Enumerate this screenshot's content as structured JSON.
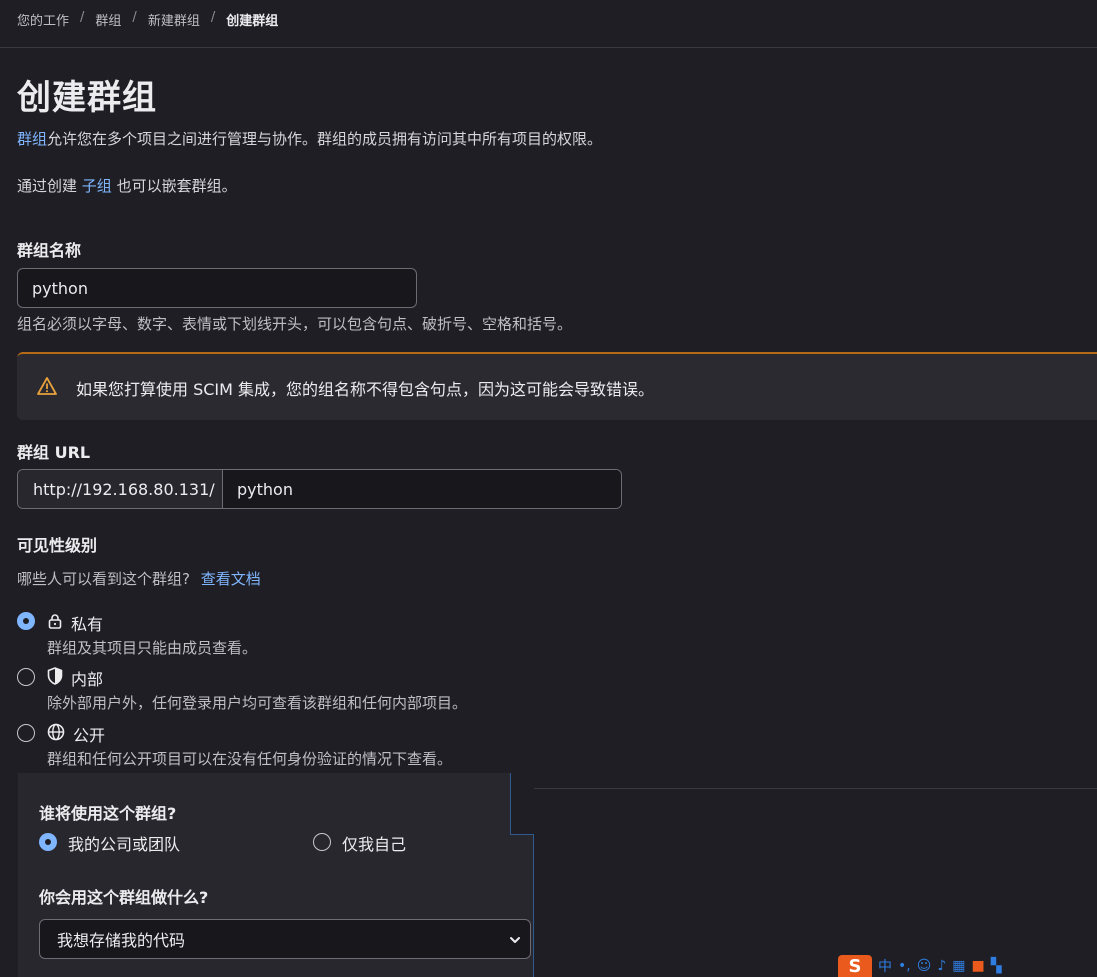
{
  "breadcrumb": {
    "items": [
      "您的工作",
      "群组",
      "新建群组",
      "创建群组"
    ],
    "separator": "/"
  },
  "page_title": "创建群组",
  "intro": {
    "link_groups": "群组",
    "text1": "允许您在多个项目之间进行管理与协作。群组的成员拥有访问其中所有项目的权限。",
    "text2_prefix": "通过创建 ",
    "link_subgroup": "子组",
    "text2_suffix": " 也可以嵌套群组。"
  },
  "group_name": {
    "label": "群组名称",
    "value": "python",
    "help": "组名必须以字母、数字、表情或下划线开头，可以包含句点、破折号、空格和括号。"
  },
  "alert": {
    "text": "如果您打算使用 SCIM 集成，您的组名称不得包含句点，因为这可能会导致错误。"
  },
  "group_url": {
    "label": "群组 URL",
    "prefix": "http://192.168.80.131/",
    "value": "python"
  },
  "visibility": {
    "label": "可见性级别",
    "question": "哪些人可以看到这个群组?",
    "docs_link": "查看文档",
    "options": [
      {
        "label": "私有",
        "desc": "群组及其项目只能由成员查看。",
        "selected": true
      },
      {
        "label": "内部",
        "desc": "除外部用户外，任何登录用户均可查看该群组和任何内部项目。",
        "selected": false
      },
      {
        "label": "公开",
        "desc": "群组和任何公开项目可以在没有任何身份验证的情况下查看。",
        "selected": false
      }
    ]
  },
  "usage": {
    "who_label": "谁将使用这个群组?",
    "who_options": [
      {
        "label": "我的公司或团队",
        "selected": true
      },
      {
        "label": "仅我自己",
        "selected": false
      }
    ],
    "what_label": "你会用这个群组做什么?",
    "what_value": "我想存储我的代码"
  },
  "tray": {
    "ime_logo": "S",
    "ime_lang": "中"
  },
  "colors": {
    "background": "#1f1e24",
    "link": "#7fb6ff",
    "alert_accent": "#b56a16"
  }
}
